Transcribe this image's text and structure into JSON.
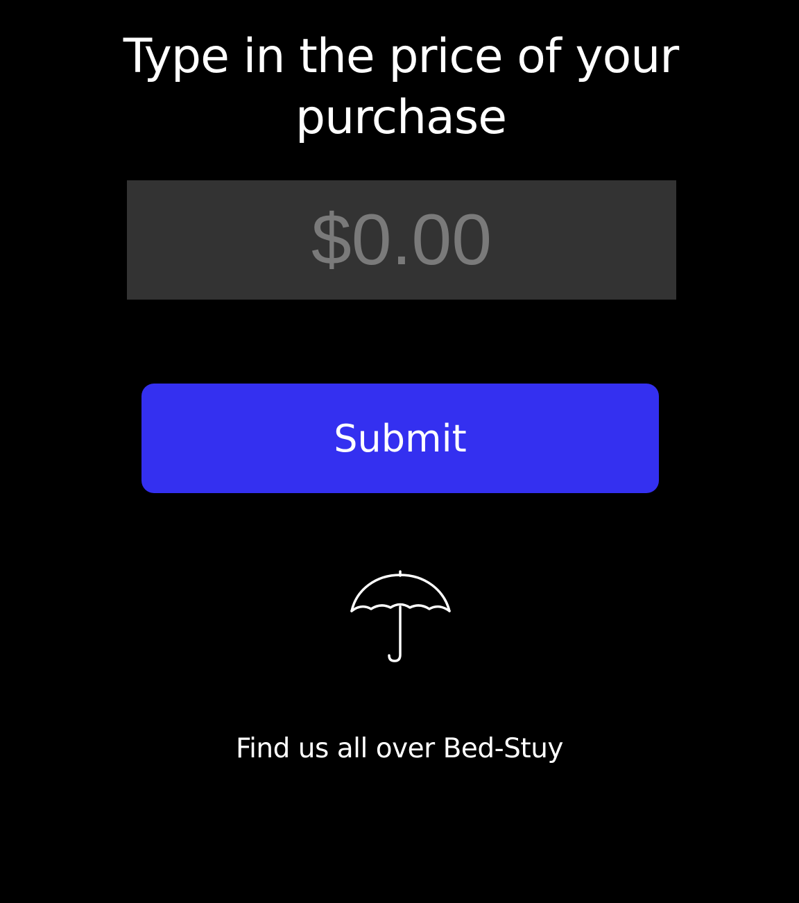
{
  "header": {
    "title": "Type in the price of your purchase"
  },
  "price_input": {
    "value": "",
    "placeholder": "$0.00"
  },
  "submit": {
    "label": "Submit"
  },
  "brand": {
    "icon": "umbrella-icon"
  },
  "footer": {
    "text": "Find us all over Bed-Stuy"
  },
  "colors": {
    "background": "#000000",
    "input_background": "#333333",
    "placeholder": "#7a7a7a",
    "accent": "#3430f0",
    "text": "#ffffff"
  }
}
